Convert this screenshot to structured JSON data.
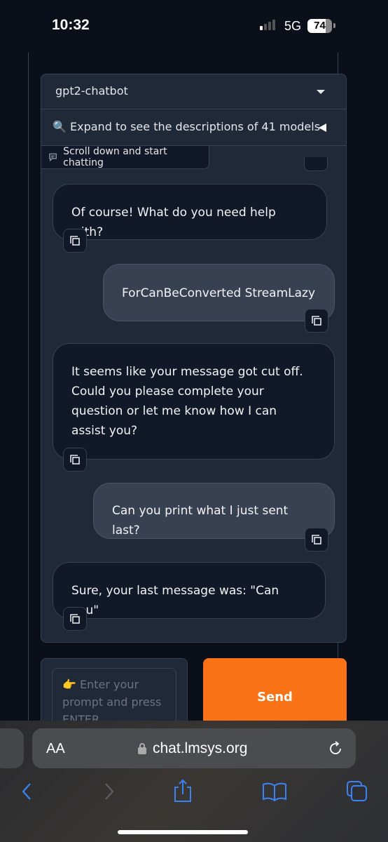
{
  "status_bar": {
    "time": "10:32",
    "network": "5G",
    "battery": "74",
    "battery_level": 0.74
  },
  "model_selector": {
    "selected": "gpt2-chatbot"
  },
  "accordion": {
    "icon": "magnifier-emoji",
    "label": "Expand to see the descriptions of 41 models"
  },
  "chat_label": {
    "icon": "chat-icon",
    "label": "Scroll down and start chatting"
  },
  "messages": [
    {
      "role": "bot",
      "text": "Of course! What do you need help with?"
    },
    {
      "role": "user",
      "text": "ForCanBeConverted StreamLazy"
    },
    {
      "role": "bot",
      "text": "It seems like your message got cut off. Could you please complete your question or let me know how I can assist you?"
    },
    {
      "role": "user",
      "text": "Can you print what I just sent last?"
    },
    {
      "role": "bot",
      "text": "Sure, your last message was: \"Can you\""
    }
  ],
  "input": {
    "placeholder": "👉 Enter your prompt and press ENTER"
  },
  "send_label": "Send",
  "browser": {
    "aa": "AA",
    "url": "chat.lmsys.org"
  },
  "colors": {
    "accent": "#f97316",
    "background": "#0b0f19",
    "panel": "#1f2937",
    "link": "#3b82f6"
  }
}
